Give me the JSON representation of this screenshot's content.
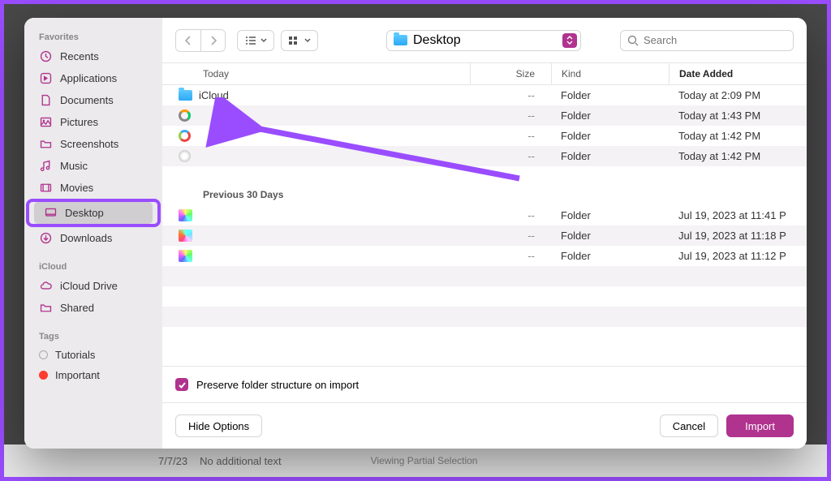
{
  "sidebar": {
    "favorites_heading": "Favorites",
    "items": [
      {
        "label": "Recents",
        "icon": "clock-icon"
      },
      {
        "label": "Applications",
        "icon": "apps-icon"
      },
      {
        "label": "Documents",
        "icon": "document-icon"
      },
      {
        "label": "Pictures",
        "icon": "picture-icon"
      },
      {
        "label": "Screenshots",
        "icon": "folder-icon"
      },
      {
        "label": "Music",
        "icon": "music-icon"
      },
      {
        "label": "Movies",
        "icon": "movie-icon"
      },
      {
        "label": "Desktop",
        "icon": "desktop-icon",
        "selected": true
      },
      {
        "label": "Downloads",
        "icon": "download-icon"
      }
    ],
    "icloud_heading": "iCloud",
    "icloud_items": [
      {
        "label": "iCloud Drive",
        "icon": "cloud-icon"
      },
      {
        "label": "Shared",
        "icon": "shared-folder-icon"
      }
    ],
    "tags_heading": "Tags",
    "tags": [
      {
        "label": "Tutorials",
        "color": "#c0c0c0"
      },
      {
        "label": "Important",
        "color": "#ff3b30"
      }
    ]
  },
  "toolbar": {
    "path_label": "Desktop",
    "search_placeholder": "Search"
  },
  "columns": {
    "name": "Today",
    "size": "Size",
    "kind": "Kind",
    "date": "Date Added"
  },
  "groups": [
    {
      "label": "Today",
      "rows": [
        {
          "name": "iCloud",
          "size": "--",
          "kind": "Folder",
          "date": "Today at 2:09 PM",
          "icon": "folder"
        },
        {
          "name": "",
          "size": "--",
          "kind": "Folder",
          "date": "Today at 1:43 PM",
          "icon": "ring"
        },
        {
          "name": "",
          "size": "--",
          "kind": "Folder",
          "date": "Today at 1:42 PM",
          "icon": "ring2"
        },
        {
          "name": "",
          "size": "--",
          "kind": "Folder",
          "date": "Today at 1:42 PM",
          "icon": "disc"
        }
      ]
    },
    {
      "label": "Previous 30 Days",
      "rows": [
        {
          "name": "",
          "size": "--",
          "kind": "Folder",
          "date": "Jul 19, 2023 at 11:41 P",
          "icon": "thumb"
        },
        {
          "name": "",
          "size": "--",
          "kind": "Folder",
          "date": "Jul 19, 2023 at 11:18 P",
          "icon": "thumb2"
        },
        {
          "name": "",
          "size": "--",
          "kind": "Folder",
          "date": "Jul 19, 2023 at 11:12 P",
          "icon": "thumb3"
        }
      ]
    }
  ],
  "options": {
    "preserve_label": "Preserve folder structure on import"
  },
  "footer": {
    "hide_options": "Hide Options",
    "cancel": "Cancel",
    "import": "Import"
  },
  "background": {
    "date": "7/7/23",
    "text": "No additional text",
    "right": "Viewing Partial Selection"
  }
}
